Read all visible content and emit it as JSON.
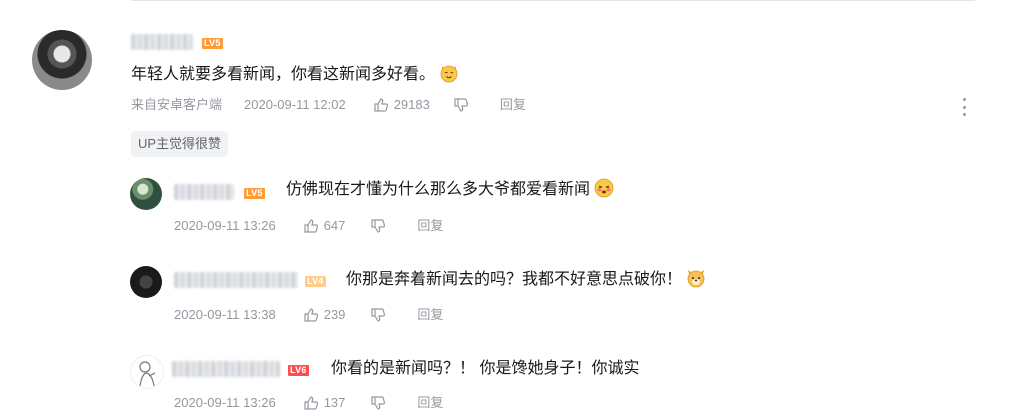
{
  "main_comment": {
    "level": "LV5",
    "text": "年轻人就要多看新闻，你看这新闻多好看。",
    "emoji_icon": "cat-smile-emoji",
    "source": "来自安卓客户端",
    "time": "2020-09-11 12:02",
    "likes": "29183",
    "reply_label": "回复",
    "badge": "UP主觉得很赞"
  },
  "replies": [
    {
      "level": "LV5",
      "text": "仿佛现在才懂为什么那么多大爷都爱看新闻",
      "emoji_icon": "blushing-face-emoji",
      "time": "2020-09-11 13:26",
      "likes": "647",
      "reply_label": "回复"
    },
    {
      "level": "LV4",
      "text": "你那是奔着新闻去的吗？我都不好意思点破你！",
      "emoji_icon": "dog-face-emoji",
      "time": "2020-09-11 13:38",
      "likes": "239",
      "reply_label": "回复"
    },
    {
      "level": "LV6",
      "text": "你看的是新闻吗？！ 你是馋她身子！你诚实",
      "time": "2020-09-11 13:26",
      "likes": "137",
      "reply_label": "回复"
    }
  ],
  "colors": {
    "meta_text": "#9499a0",
    "lv5": "#ff9c38",
    "lv4": "#ffcc88",
    "lv6": "#ff4c4c"
  }
}
